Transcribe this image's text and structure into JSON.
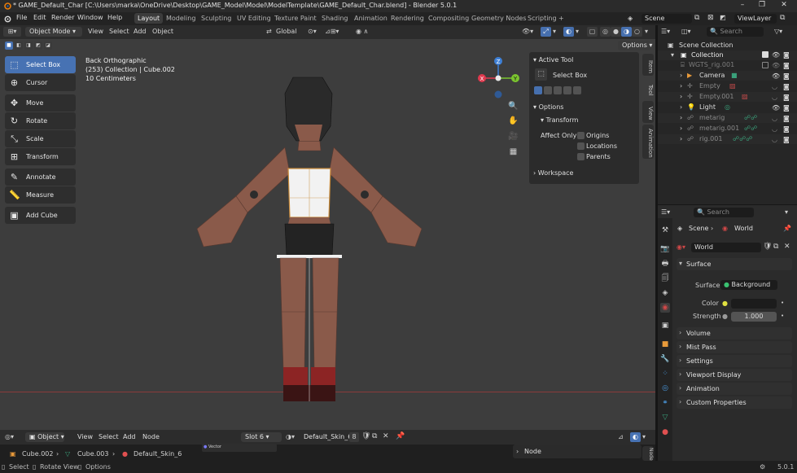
{
  "titlebar": {
    "title": "* GAME_Default_Char [C:\\Users\\marka\\OneDrive\\Desktop\\GAME_Model\\Model\\ModelTemplate\\GAME_Default_Char.blend] - Blender 5.0.1",
    "minimize": "–",
    "maximize": "❐",
    "close": "✕"
  },
  "menu": [
    "File",
    "Edit",
    "Render",
    "Window",
    "Help"
  ],
  "workspaces": [
    "Layout",
    "Modeling",
    "Sculpting",
    "UV Editing",
    "Texture Paint",
    "Shading",
    "Animation",
    "Rendering",
    "Compositing",
    "Geometry Nodes",
    "Scripting"
  ],
  "add_workspace": "+",
  "scene": {
    "label": "Scene",
    "view_layer": "ViewLayer"
  },
  "viewport_header": {
    "mode": "Object Mode",
    "menus": [
      "View",
      "Select",
      "Add",
      "Object"
    ],
    "orientation": "Global",
    "options_label": "Options"
  },
  "overlay": {
    "view_name": "Back Orthographic",
    "collection_info": "(253) Collection | Cube.002",
    "scale_info": "10 Centimeters"
  },
  "gizmo": {
    "z": "Z",
    "y": "Y",
    "x": "X"
  },
  "tools": [
    {
      "label": "Select Box",
      "icon": "⬚"
    },
    {
      "label": "Cursor",
      "icon": "⊕"
    },
    {
      "label": "Move",
      "icon": "✥"
    },
    {
      "label": "Rotate",
      "icon": "↻"
    },
    {
      "label": "Scale",
      "icon": "⤡"
    },
    {
      "label": "Transform",
      "icon": "⊞"
    },
    {
      "label": "Annotate",
      "icon": "✎"
    },
    {
      "label": "Measure",
      "icon": "📏"
    },
    {
      "label": "Add Cube",
      "icon": "▣"
    }
  ],
  "npanel": {
    "active_tool_header": "Active Tool",
    "active_tool_name": "Select Box",
    "options_header": "Options",
    "transform_header": "Transform",
    "affect_only": "Affect Only",
    "origins": "Origins",
    "locations": "Locations",
    "parents": "Parents",
    "workspace_header": "Workspace",
    "tabs": [
      "Item",
      "Tool",
      "View",
      "Animation"
    ]
  },
  "outliner": {
    "search_placeholder": "Search",
    "scene_collection": "Scene Collection",
    "items": [
      {
        "name": "Collection",
        "dim": false
      },
      {
        "name": "WGTS_rig.001",
        "dim": true
      },
      {
        "name": "Camera",
        "dim": false
      },
      {
        "name": "Empty",
        "dim": true
      },
      {
        "name": "Empty.001",
        "dim": true
      },
      {
        "name": "Light",
        "dim": false
      },
      {
        "name": "metarig",
        "dim": true
      },
      {
        "name": "metarig.001",
        "dim": true
      },
      {
        "name": "rig.001",
        "dim": true
      }
    ]
  },
  "properties": {
    "search_placeholder": "Search",
    "breadcrumb_scene": "Scene",
    "breadcrumb_world": "World",
    "world_name": "World",
    "surface_header": "Surface",
    "surface_label": "Surface",
    "surface_value": "Background",
    "color_label": "Color",
    "strength_label": "Strength",
    "strength_value": "1.000",
    "panels": [
      "Volume",
      "Mist Pass",
      "Settings",
      "Viewport Display",
      "Animation",
      "Custom Properties"
    ]
  },
  "node_editor": {
    "type": "Object",
    "menus": [
      "View",
      "Select",
      "Add",
      "Node"
    ],
    "slot": "Slot 6",
    "material": "Default_Skin_6",
    "users": "8",
    "breadcrumb": [
      "Cube.002",
      "Cube.003",
      "Default_Skin_6"
    ],
    "node_panel": "Node",
    "node_tab": "Node",
    "vector_socket": "Vector"
  },
  "statusbar": {
    "select": "Select",
    "rotate_view": "Rotate View",
    "options": "Options",
    "version": "5.0.1"
  },
  "colors": {
    "accent": "#4772b3",
    "skin": "#8a5a4a",
    "hair": "#2a2a2a",
    "shirt": "#f2f2f2",
    "shorts": "#232323",
    "boots": "#8c2424"
  }
}
